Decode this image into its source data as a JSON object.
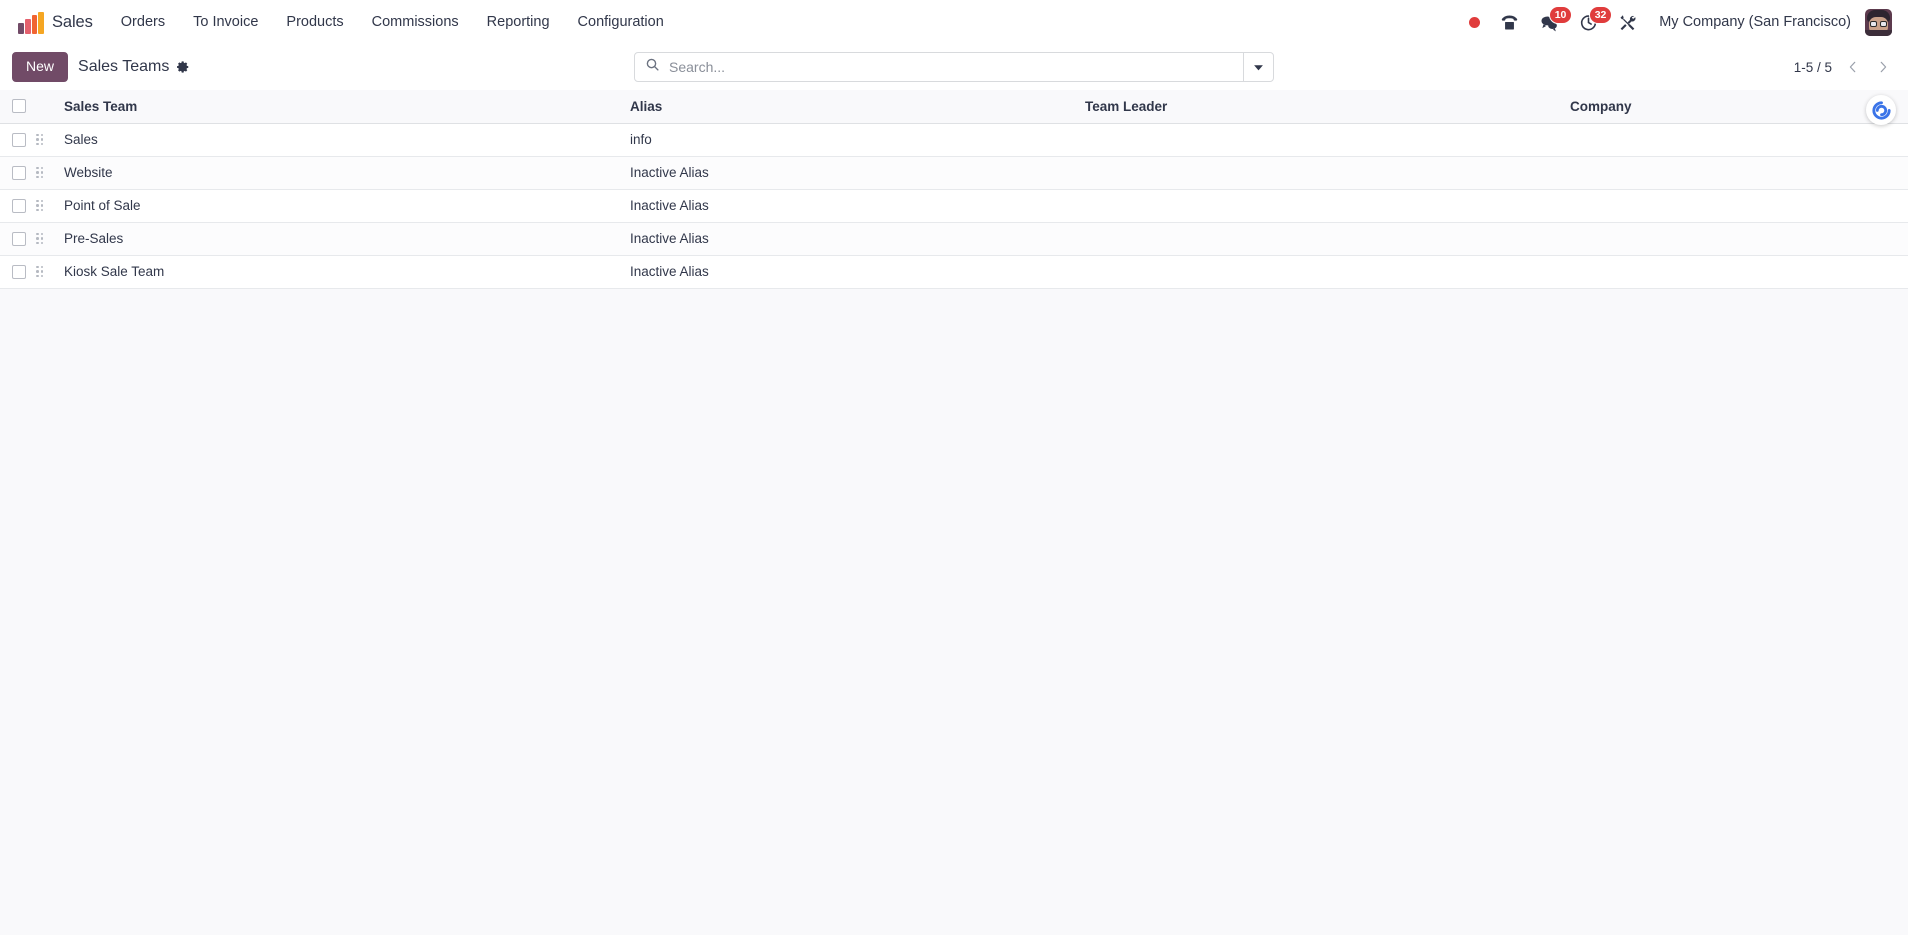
{
  "navbar": {
    "brand": {
      "label": "Sales",
      "icon": "sales-bar-chart-logo"
    },
    "menus": [
      {
        "label": "Orders"
      },
      {
        "label": "To Invoice"
      },
      {
        "label": "Products"
      },
      {
        "label": "Commissions"
      },
      {
        "label": "Reporting"
      },
      {
        "label": "Configuration"
      }
    ],
    "systray": [
      {
        "name": "recording-indicator",
        "icon": "red-dot",
        "badge": ""
      },
      {
        "name": "voip-phone",
        "icon": "phone-icon",
        "badge": ""
      },
      {
        "name": "messages",
        "icon": "chat-bubbles-icon",
        "badge": "10"
      },
      {
        "name": "activities",
        "icon": "clock-icon",
        "badge": "32"
      },
      {
        "name": "debug-tools",
        "icon": "tools-icon",
        "badge": ""
      }
    ],
    "company": "My Company (San Francisco)",
    "avatar_alt": "user-avatar"
  },
  "control_panel": {
    "new_button": "New",
    "breadcrumb": "Sales Teams",
    "settings_icon": "gear-icon",
    "search": {
      "placeholder": "Search...",
      "value": "",
      "icon": "search-icon",
      "toggle_icon": "caret-down-icon"
    },
    "pager": {
      "range": "1-5 / 5",
      "previous_icon": "chevron-left-icon",
      "next_icon": "chevron-right-icon"
    }
  },
  "list_view": {
    "columns": [
      {
        "key": "name",
        "label": "Sales Team"
      },
      {
        "key": "alias",
        "label": "Alias"
      },
      {
        "key": "leader",
        "label": "Team Leader"
      },
      {
        "key": "company",
        "label": "Company"
      }
    ],
    "rows": [
      {
        "name": "Sales",
        "alias": "info",
        "leader": "",
        "company": ""
      },
      {
        "name": "Website",
        "alias": "Inactive Alias",
        "leader": "",
        "company": ""
      },
      {
        "name": "Point of Sale",
        "alias": "Inactive Alias",
        "leader": "",
        "company": ""
      },
      {
        "name": "Pre-Sales",
        "alias": "Inactive Alias",
        "leader": "",
        "company": ""
      },
      {
        "name": "Kiosk Sale Team",
        "alias": "Inactive Alias",
        "leader": "",
        "company": ""
      }
    ],
    "row_checkbox": "row-select-checkbox",
    "row_handle": "drag-handle-icon",
    "select_all": "select-all-checkbox"
  },
  "floating_button": {
    "name": "odoo-assistant-spiral",
    "icon": "blue-spiral-icon"
  },
  "colors": {
    "brand_primary": "#714B67",
    "badge_red": "#e03c3c",
    "spiral_blue": "#3b74e8",
    "text": "#31374a",
    "row_stripe": "#fcfcfd",
    "header_bg": "#f9f9fb"
  }
}
